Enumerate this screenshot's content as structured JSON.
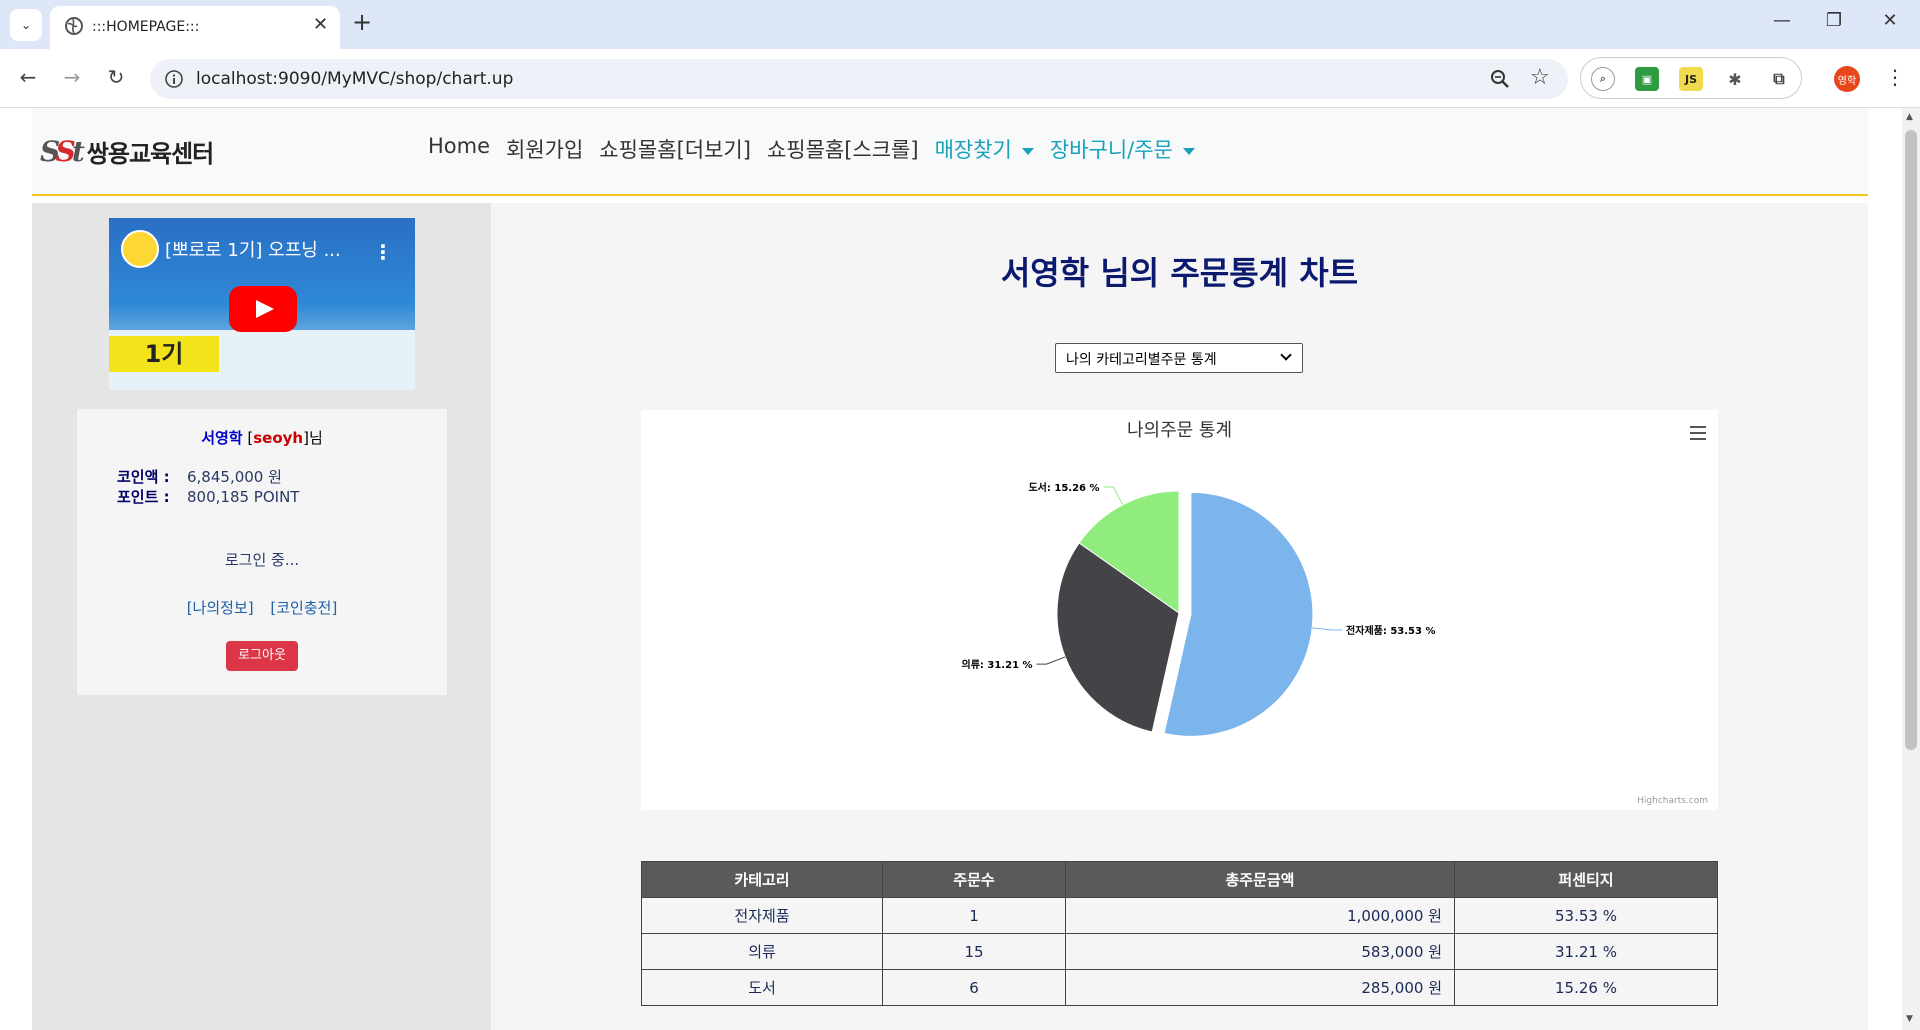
{
  "browser": {
    "tab_title": ":::HOMEPAGE:::",
    "url": "localhost:9090/MyMVC/shop/chart.up",
    "profile_initials": "영학"
  },
  "site": {
    "logo_text": "쌍용교육센터",
    "menu": [
      {
        "label": "Home",
        "dropdown": false
      },
      {
        "label": "회원가입",
        "dropdown": false
      },
      {
        "label": "쇼핑몰홈[더보기]",
        "dropdown": false
      },
      {
        "label": "쇼핑몰홈[스크롤]",
        "dropdown": false
      },
      {
        "label": "매장찾기",
        "dropdown": true
      },
      {
        "label": "장바구니/주문",
        "dropdown": true
      }
    ]
  },
  "sidebar": {
    "video": {
      "title": "[뽀로로 1기] 오프닝 ...",
      "badge": "1기",
      "logo": "뽀로로"
    },
    "user": {
      "name": "서영학",
      "id": "seoyh",
      "suffix": "님",
      "coin_label": "코인액 :",
      "coin_value": "6,845,000 원",
      "point_label": "포인트 :",
      "point_value": "800,185 POINT",
      "status": "로그인 중...",
      "link_info": "[나의정보]",
      "link_charge": "[코인충전]",
      "logout": "로그아웃"
    }
  },
  "main": {
    "title": "서영학 님의 주문통계 차트",
    "select_value": "나의 카테고리별주문 통계",
    "chart_credit": "Highcharts.com"
  },
  "chart_data": {
    "type": "pie",
    "title": "나의주문 통계",
    "slices": [
      {
        "name": "전자제품",
        "value": 53.53,
        "label": "전자제품: 53.53 %",
        "color": "#7cb5ec",
        "sliced": true
      },
      {
        "name": "의류",
        "value": 31.21,
        "label": "의류: 31.21 %",
        "color": "#434348",
        "sliced": false
      },
      {
        "name": "도서",
        "value": 15.26,
        "label": "도서: 15.26 %",
        "color": "#90ed7d",
        "sliced": false
      }
    ]
  },
  "table": {
    "headers": [
      "카테고리",
      "주문수",
      "총주문금액",
      "퍼센티지"
    ],
    "rows": [
      [
        "전자제품",
        "1",
        "1,000,000 원",
        "53.53 %"
      ],
      [
        "의류",
        "15",
        "583,000 원",
        "31.21 %"
      ],
      [
        "도서",
        "6",
        "285,000 원",
        "15.26 %"
      ]
    ]
  }
}
